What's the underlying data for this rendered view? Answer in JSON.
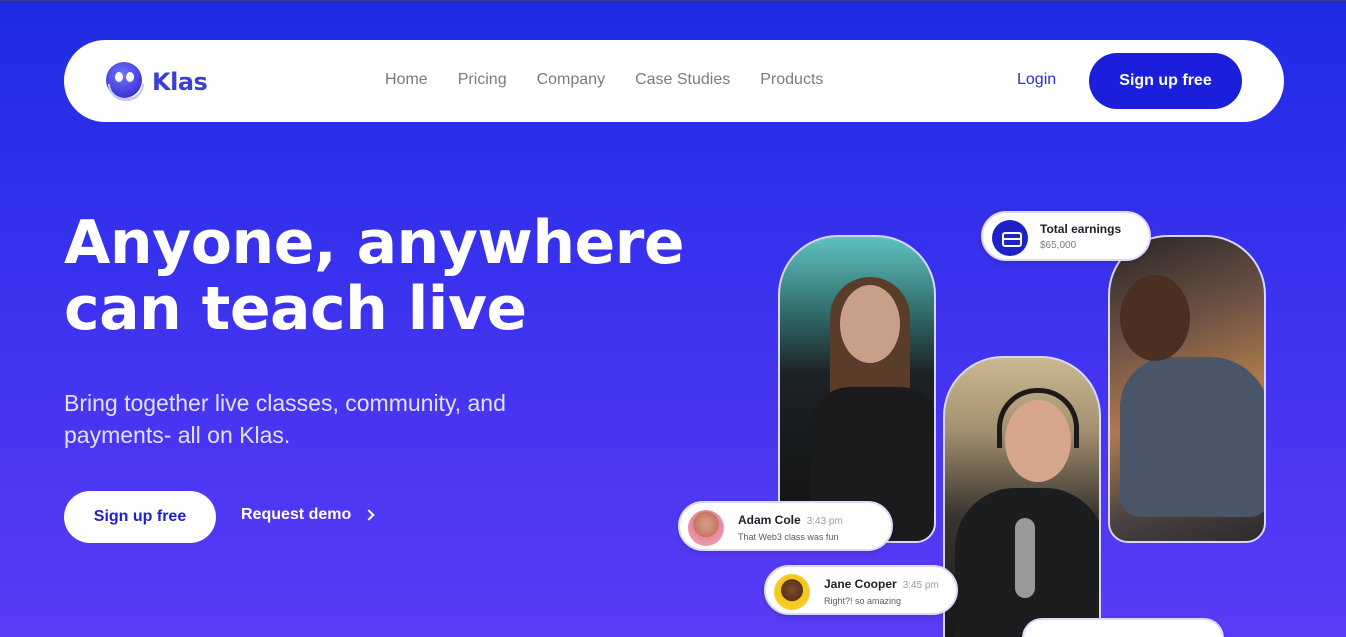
{
  "brand": {
    "name": "Klas"
  },
  "nav": {
    "links": [
      "Home",
      "Pricing",
      "Company",
      "Case Studies",
      "Products"
    ],
    "login": "Login",
    "signup": "Sign up free"
  },
  "hero": {
    "headline_line1": "Anyone, anywhere",
    "headline_line2": "can teach live",
    "subline": "Bring together live classes, community, and payments- all on Klas.",
    "cta_primary": "Sign up free",
    "cta_secondary": "Request demo"
  },
  "earnings_card": {
    "title": "Total earnings",
    "value": "$65,000",
    "icon": "wallet-icon"
  },
  "messages": [
    {
      "name": "Adam Cole",
      "time": "3:43 pm",
      "text": "That Web3 class was fun"
    },
    {
      "name": "Jane Cooper",
      "time": "3:45 pm",
      "text": "Right?! so amazing"
    }
  ],
  "colors": {
    "accent": "#1b1fdc",
    "background_top": "#1e2be3",
    "background_bottom": "#5a3cf6",
    "logo_text": "#3c3fd4"
  }
}
